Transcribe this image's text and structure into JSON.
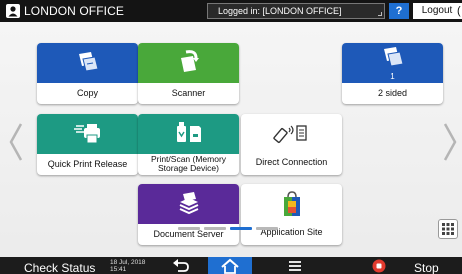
{
  "topbar": {
    "office_title": "LONDON OFFICE",
    "login_status": "Logged in: [LONDON OFFICE]",
    "help_label": "?",
    "logout_label": "Logout",
    "moon_label": "("
  },
  "tiles": {
    "copy": "Copy",
    "scanner": "Scanner",
    "two_sided": "2 sided",
    "two_sided_count": "1",
    "quick_print_release": "Quick Print Release",
    "print_scan_line1": "Print/Scan (Memory",
    "print_scan_line2": "Storage Device)",
    "direct_connection": "Direct Connection",
    "document_server": "Document Server",
    "application_site": "Application Site"
  },
  "bottombar": {
    "check_status": "Check Status",
    "date": "18 Jul, 2018",
    "time": "15:41",
    "stop_label": "Stop"
  },
  "colors": {
    "copy": "#1e59b8",
    "scanner": "#49a83a",
    "quick_print": "#1d9a83",
    "print_scan": "#1d9a83",
    "document_server": "#5a2a99",
    "home_accent": "#1f6fd1"
  },
  "icons": {
    "user": "user-icon",
    "copy": "copy-icon",
    "scanner": "scanner-icon",
    "two_sided": "two-sided-copy-icon",
    "quick_print": "quick-print-icon",
    "print_scan": "memory-storage-icon",
    "direct_connection": "direct-connection-icon",
    "document_server": "document-server-icon",
    "application_site": "shopping-bag-icon",
    "grid": "app-grid-icon",
    "back": "back-arrow-icon",
    "home": "home-icon",
    "menu": "menu-icon",
    "stop": "stop-icon"
  }
}
